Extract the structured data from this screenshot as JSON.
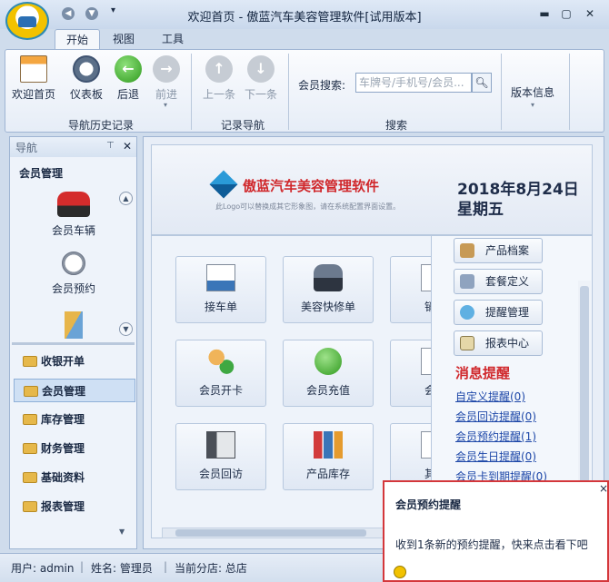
{
  "window": {
    "title": "欢迎首页 - 傲蓝汽车美容管理软件[试用版本]"
  },
  "tabs": [
    {
      "label": "开始"
    },
    {
      "label": "视图"
    },
    {
      "label": "工具"
    }
  ],
  "ribbon": {
    "nav_history": {
      "buttons": [
        "欢迎首页",
        "仪表板",
        "后退",
        "前进"
      ],
      "group_label": "导航历史记录"
    },
    "record_nav": {
      "buttons": [
        "上一条",
        "下一条"
      ],
      "group_label": "记录导航"
    },
    "search": {
      "label": "会员搜索:",
      "placeholder": "车牌号/手机号/会员...",
      "group_label": "搜索"
    },
    "version": {
      "label": "版本信息"
    }
  },
  "sidebar": {
    "header": "导航",
    "section_title": "会员管理",
    "icon_items": [
      "会员车辆",
      "会员预约"
    ],
    "nav_items": [
      "收银开单",
      "会员管理",
      "库存管理",
      "财务管理",
      "基础资料",
      "报表管理"
    ],
    "selected": "会员管理"
  },
  "banner": {
    "brand": "傲蓝汽车美容管理软件",
    "subtitle": "此Logo可以替换成其它形象图，请在系统配置界面设置。",
    "date": "2018年8月24日",
    "weekday": "星期五"
  },
  "tiles": [
    {
      "label": "接车单",
      "icon": "clipboard-car-icon"
    },
    {
      "label": "美容快修单",
      "icon": "car-front-icon"
    },
    {
      "label": "销售",
      "icon": "document-icon"
    },
    {
      "label": "会员开卡",
      "icon": "add-users-icon"
    },
    {
      "label": "会员充值",
      "icon": "green-document-icon"
    },
    {
      "label": "会员",
      "icon": "document-icon"
    },
    {
      "label": "会员回访",
      "icon": "phone-icon"
    },
    {
      "label": "产品库存",
      "icon": "bar-chart-icon"
    },
    {
      "label": "其它",
      "icon": "document-icon"
    }
  ],
  "right_panel": {
    "buttons": [
      "产品档案",
      "套餐定义",
      "提醒管理",
      "报表中心"
    ],
    "messages_title": "消息提醒",
    "reminders": [
      "自定义提醒(0)",
      "会员回访提醒(0)",
      "会员预约提醒(1)",
      "会员生日提醒(0)",
      "会员卡到期提醒(0)"
    ]
  },
  "status": {
    "user": "用户: admin",
    "name": "姓名: 管理员",
    "branch": "当前分店: 总店"
  },
  "popup": {
    "title": "会员预约提醒",
    "message": "收到1条新的预约提醒，快来点击看下吧",
    "close": "×"
  },
  "colors": {
    "accent_red": "#d0272b",
    "link_blue": "#1d47a8",
    "frame_blue": "#9fb5d3"
  }
}
